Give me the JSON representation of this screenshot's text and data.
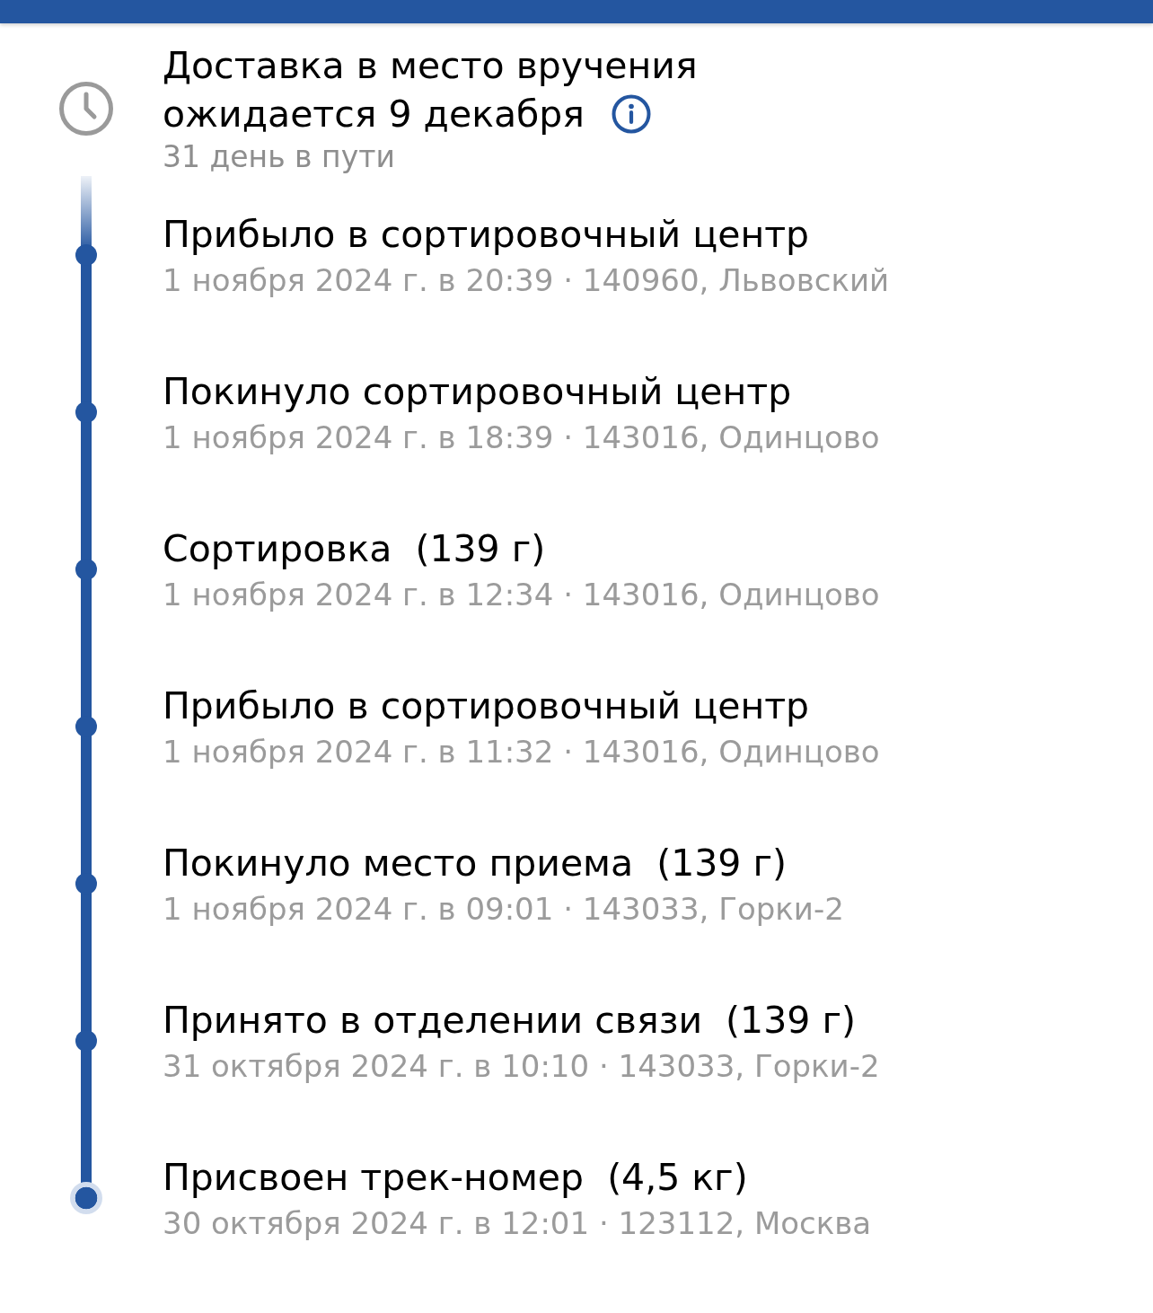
{
  "header": {
    "title_lines": [
      "Доставка в место вручения",
      "ожидается 9 декабря"
    ],
    "subtitle": "31 день в пути"
  },
  "events": [
    {
      "kind": "step",
      "title": "Прибыло в сортировочный центр",
      "details": "1 ноября 2024 г. в 20:39 · 140960, Львовский"
    },
    {
      "kind": "step",
      "title": "Покинуло сортировочный центр",
      "details": "1 ноября 2024 г. в 18:39 · 143016, Одинцово"
    },
    {
      "kind": "step",
      "title": "Сортировка",
      "weight": "(139 г)",
      "details": "1 ноября 2024 г. в 12:34 · 143016, Одинцово"
    },
    {
      "kind": "step",
      "title": "Прибыло в сортировочный центр",
      "details": "1 ноября 2024 г. в 11:32 · 143016, Одинцово"
    },
    {
      "kind": "step",
      "title": "Покинуло место приема",
      "weight": "(139 г)",
      "details": "1 ноября 2024 г. в 09:01 · 143033, Горки-2"
    },
    {
      "kind": "step",
      "title": "Принято в отделении связи",
      "weight": "(139 г)",
      "details": "31 октября 2024 г. в 10:10 · 143033, Горки-2"
    },
    {
      "kind": "start",
      "title": "Присвоен трек-номер",
      "weight": "(4,5 кг)",
      "details": "30 октября 2024 г. в 12:01 · 123112, Москва"
    }
  ]
}
